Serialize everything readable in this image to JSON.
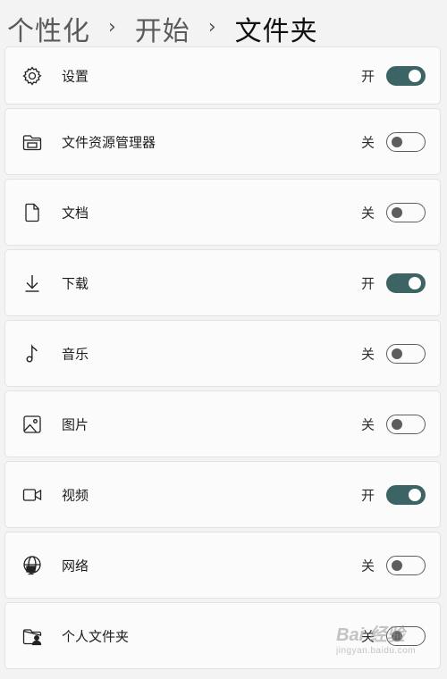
{
  "breadcrumb": [
    "个性化",
    "开始",
    "文件夹"
  ],
  "breadcrumb_separator": "›",
  "items": [
    {
      "label": "设置",
      "state": "开",
      "on": true,
      "icon": "gear-icon"
    },
    {
      "label": "文件资源管理器",
      "state": "关",
      "on": false,
      "icon": "file-explorer-icon"
    },
    {
      "label": "文档",
      "state": "关",
      "on": false,
      "icon": "document-icon"
    },
    {
      "label": "下载",
      "state": "开",
      "on": true,
      "icon": "download-icon"
    },
    {
      "label": "音乐",
      "state": "关",
      "on": false,
      "icon": "music-note-icon"
    },
    {
      "label": "图片",
      "state": "关",
      "on": false,
      "icon": "picture-icon"
    },
    {
      "label": "视频",
      "state": "开",
      "on": true,
      "icon": "video-camera-icon"
    },
    {
      "label": "网络",
      "state": "关",
      "on": false,
      "icon": "network-globe-icon"
    },
    {
      "label": "个人文件夹",
      "state": "关",
      "on": false,
      "icon": "personal-folder-icon"
    }
  ],
  "colors": {
    "toggle_on": "#3c6464",
    "toggle_off_border": "#5d5d5d",
    "background": "#f3f3f3"
  },
  "watermark": {
    "main": "Bai 经验",
    "sub": "jingyan.baidu.com"
  }
}
